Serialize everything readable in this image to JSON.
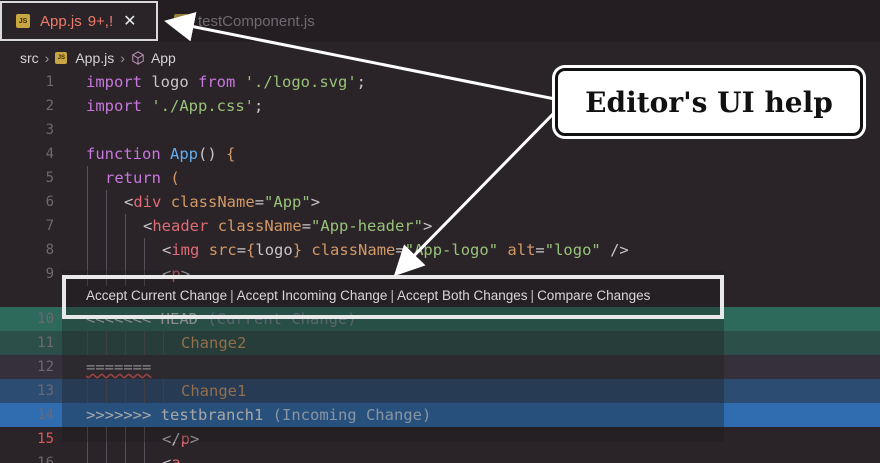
{
  "tabs": [
    {
      "name": "App.js",
      "status": "9+,!",
      "badge": "JS",
      "close": "✕",
      "active": true
    },
    {
      "name": "testComponent.js",
      "badge": "JS",
      "active": false
    }
  ],
  "breadcrumb": {
    "folder": "src",
    "file": "App.js",
    "symbol": "App",
    "separator": "›"
  },
  "codelens": {
    "actions": [
      "Accept Current Change",
      "Accept Incoming Change",
      "Accept Both Changes",
      "Compare Changes"
    ],
    "separator": "|"
  },
  "lines": {
    "n1": "1",
    "n2": "2",
    "n3": "3",
    "n4": "4",
    "n5": "5",
    "n6": "6",
    "n7": "7",
    "n8": "8",
    "n9": "9",
    "n10": "10",
    "n11": "11",
    "n12": "12",
    "n13": "13",
    "n14": "14",
    "n15": "15",
    "n16": "16",
    "l10_marker": "<<<<<<< HEAD",
    "l10_note": "(Current Change)",
    "l11": "Change2",
    "l12": "=======",
    "l13": "Change1",
    "l14_marker": ">>>>>>> testbranch1",
    "l14_note": "(Incoming Change)"
  },
  "callout": {
    "text": "Editor's UI help"
  },
  "colors": {
    "current_change": "#2d6a5c",
    "incoming_change": "#2f6cb0",
    "error_text": "#f07a6a",
    "editor_bg": "#2a2328"
  }
}
